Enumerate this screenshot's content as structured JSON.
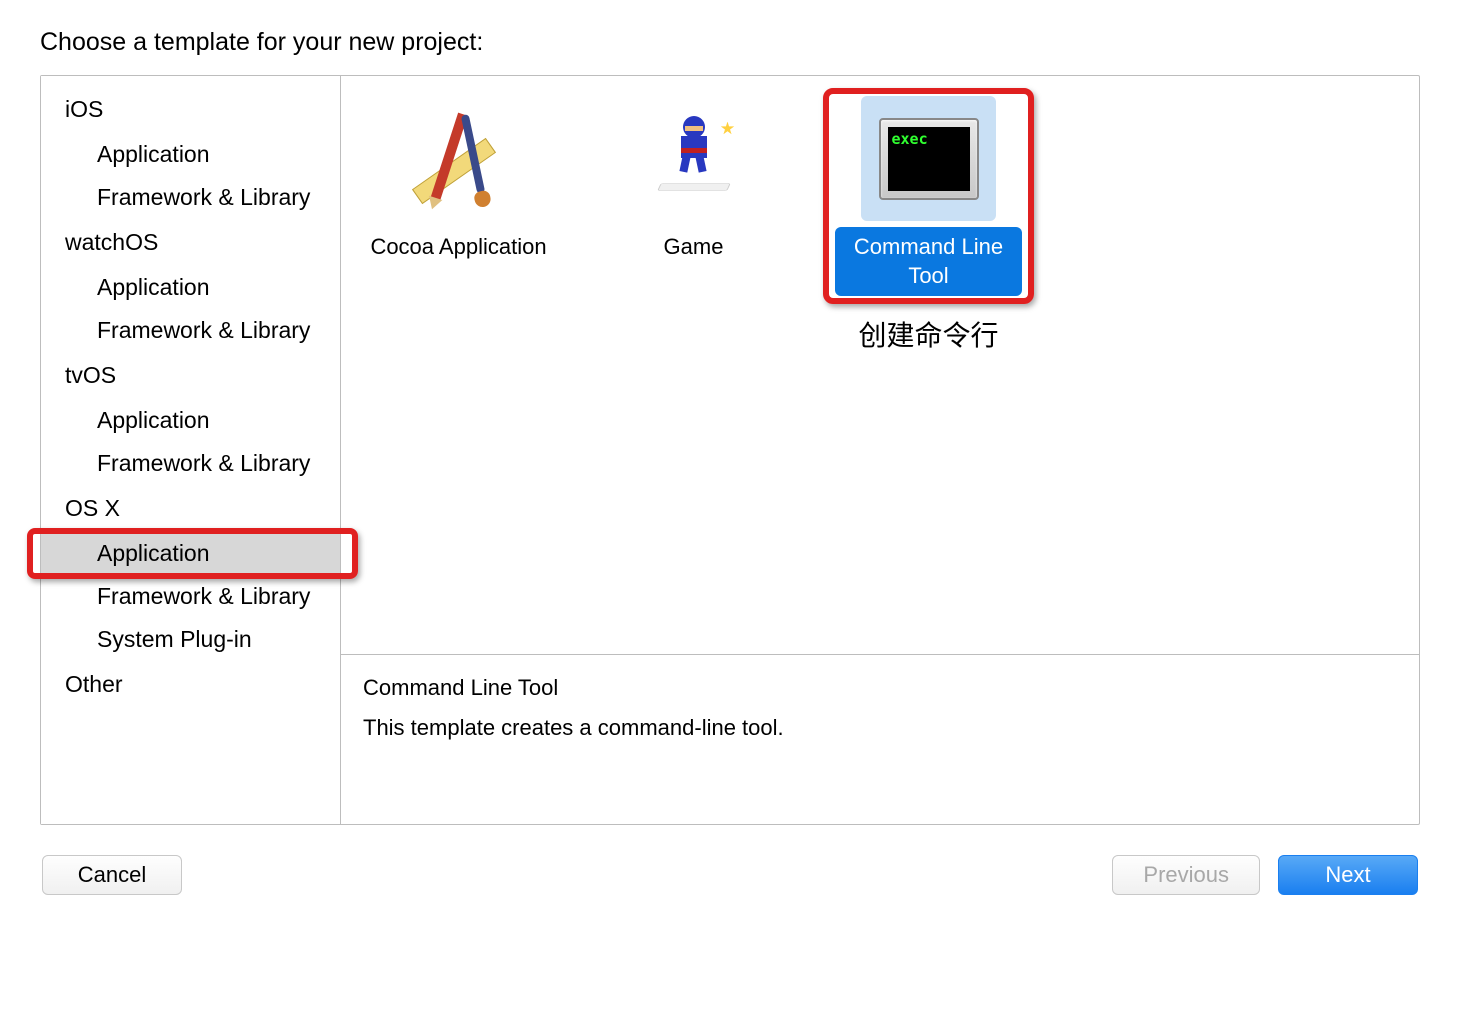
{
  "title": "Choose a template for your new project:",
  "sidebar": {
    "categories": [
      {
        "name": "iOS",
        "items": [
          "Application",
          "Framework & Library"
        ]
      },
      {
        "name": "watchOS",
        "items": [
          "Application",
          "Framework & Library"
        ]
      },
      {
        "name": "tvOS",
        "items": [
          "Application",
          "Framework & Library"
        ]
      },
      {
        "name": "OS X",
        "items": [
          "Application",
          "Framework & Library",
          "System Plug-in"
        ]
      },
      {
        "name": "Other",
        "items": []
      }
    ],
    "selected": {
      "category": "OS X",
      "item": "Application"
    }
  },
  "templates": [
    {
      "id": "cocoa",
      "label": "Cocoa Application",
      "selected": false
    },
    {
      "id": "game",
      "label": "Game",
      "selected": false
    },
    {
      "id": "cli",
      "label": "Command Line Tool",
      "selected": true
    }
  ],
  "annotation": "创建命令行",
  "description": {
    "title": "Command Line Tool",
    "text": "This template creates a command-line tool."
  },
  "buttons": {
    "cancel": "Cancel",
    "previous": "Previous",
    "next": "Next"
  }
}
